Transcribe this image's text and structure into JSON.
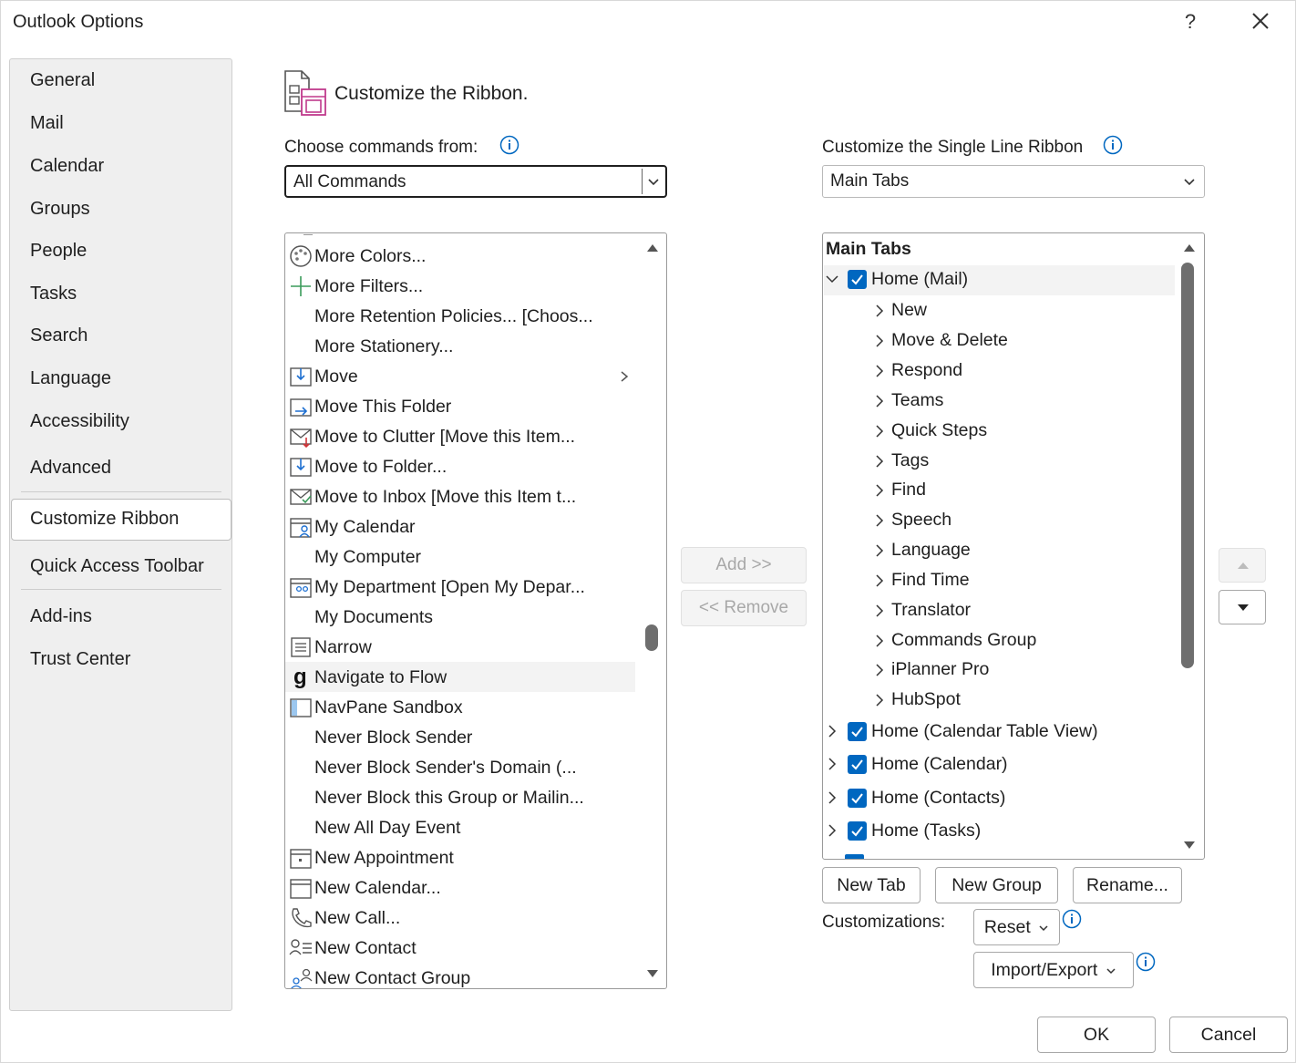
{
  "window": {
    "title": "Outlook Options",
    "help_label": "?"
  },
  "nav": {
    "items": [
      {
        "label": "General"
      },
      {
        "label": "Mail"
      },
      {
        "label": "Calendar"
      },
      {
        "label": "Groups"
      },
      {
        "label": "People"
      },
      {
        "label": "Tasks"
      },
      {
        "label": "Search"
      },
      {
        "label": "Language"
      },
      {
        "label": "Accessibility"
      },
      {
        "label": "Advanced"
      },
      {
        "label": "Customize Ribbon",
        "selected": true
      },
      {
        "label": "Quick Access Toolbar"
      },
      {
        "label": "Add-ins"
      },
      {
        "label": "Trust Center"
      }
    ]
  },
  "header": {
    "title": "Customize the Ribbon."
  },
  "commands": {
    "label": "Choose commands from:",
    "selected": "All Commands",
    "items": [
      {
        "label": "More Colors...",
        "icon": "palette-icon"
      },
      {
        "label": "More Filters...",
        "icon": "plus-icon"
      },
      {
        "label": "More Retention Policies... [Choos...",
        "icon": ""
      },
      {
        "label": "More Stationery...",
        "icon": ""
      },
      {
        "label": "Move",
        "icon": "move-icon",
        "submenu": true
      },
      {
        "label": "Move This Folder",
        "icon": "move-folder-icon"
      },
      {
        "label": "Move to Clutter [Move this Item...",
        "icon": "move-clutter-icon"
      },
      {
        "label": "Move to Folder...",
        "icon": "move-to-folder-icon"
      },
      {
        "label": "Move to Inbox [Move this Item t...",
        "icon": "move-inbox-icon"
      },
      {
        "label": "My Calendar",
        "icon": "my-calendar-icon"
      },
      {
        "label": "My Computer",
        "icon": ""
      },
      {
        "label": "My Department [Open My Depar...",
        "icon": "department-calendar-icon"
      },
      {
        "label": "My Documents",
        "icon": ""
      },
      {
        "label": "Narrow",
        "icon": "narrow-icon"
      },
      {
        "label": "Navigate to Flow",
        "icon": "flow-icon",
        "highlighted": true
      },
      {
        "label": "NavPane Sandbox",
        "icon": "navpane-icon"
      },
      {
        "label": "Never Block Sender",
        "icon": ""
      },
      {
        "label": "Never Block Sender's Domain (...",
        "icon": ""
      },
      {
        "label": "Never Block this Group or Mailin...",
        "icon": ""
      },
      {
        "label": "New All Day Event",
        "icon": ""
      },
      {
        "label": "New Appointment",
        "icon": "appointment-icon"
      },
      {
        "label": "New Calendar...",
        "icon": "calendar-icon"
      },
      {
        "label": "New Call...",
        "icon": "phone-icon"
      },
      {
        "label": "New Contact",
        "icon": "contact-icon"
      },
      {
        "label": "New Contact Group",
        "icon": "contact-group-icon"
      }
    ]
  },
  "middle": {
    "add_label": "Add >>",
    "remove_label": "<< Remove"
  },
  "ribbon": {
    "label": "Customize the Single Line Ribbon",
    "selected": "Main Tabs",
    "tree_header": "Main Tabs",
    "home_mail": "Home (Mail)",
    "home_mail_groups": [
      "New",
      "Move & Delete",
      "Respond",
      "Teams",
      "Quick Steps",
      "Tags",
      "Find",
      "Speech",
      "Language",
      "Find Time",
      "Translator",
      "Commands Group",
      "iPlanner Pro",
      "HubSpot"
    ],
    "other_tabs": [
      "Home (Calendar Table View)",
      "Home (Calendar)",
      "Home (Contacts)",
      "Home (Tasks)"
    ]
  },
  "tree_buttons": {
    "new_tab": "New Tab",
    "new_group": "New Group",
    "rename": "Rename..."
  },
  "customizations": {
    "label": "Customizations:",
    "reset": "Reset",
    "import_export": "Import/Export"
  },
  "footer": {
    "ok": "OK",
    "cancel": "Cancel"
  },
  "colors": {
    "checkbox": "#0067c0",
    "accent": "#0067c0"
  }
}
